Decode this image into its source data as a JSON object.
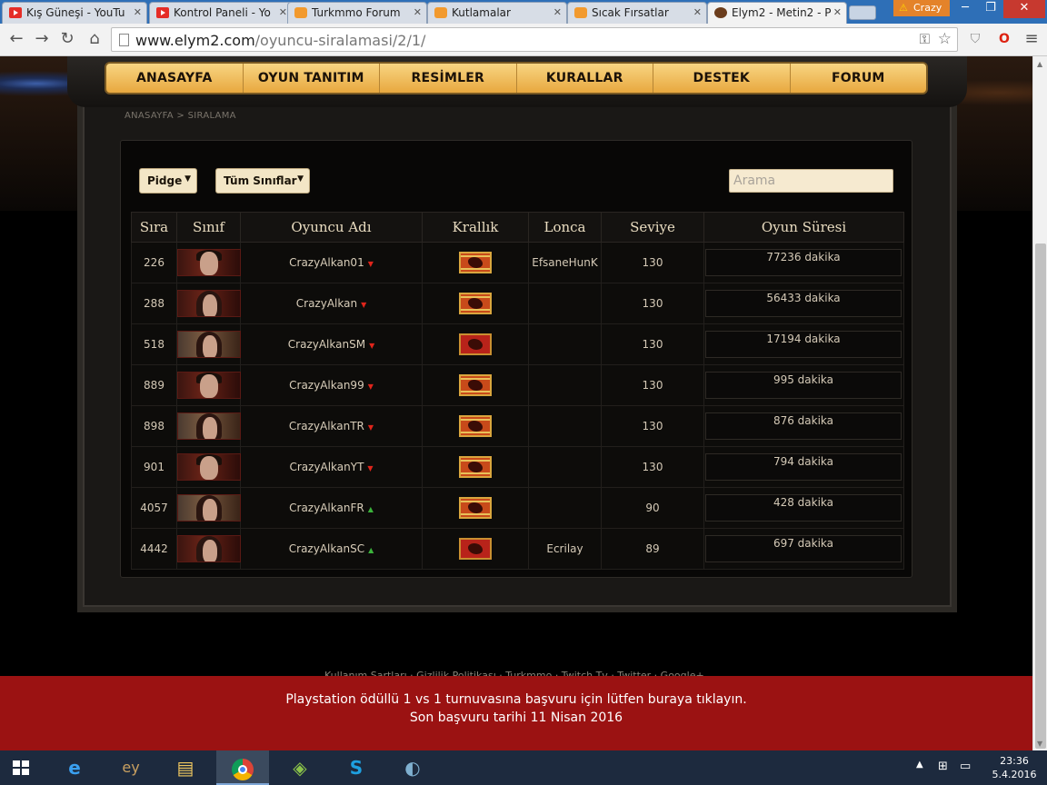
{
  "browser": {
    "tabs": [
      {
        "title": "Kış Güneşi - YouTu",
        "favicon": "youtube-icon"
      },
      {
        "title": "Kontrol Paneli - Yo",
        "favicon": "youtube-icon"
      },
      {
        "title": "Turkmmo Forum",
        "favicon": "turkmmo-icon"
      },
      {
        "title": "Kutlamalar",
        "favicon": "turkmmo-icon"
      },
      {
        "title": "Sıcak Fırsatlar",
        "favicon": "turkmmo-icon"
      },
      {
        "title": "Elym2 - Metin2 - P",
        "favicon": "elym2-icon",
        "active": true
      }
    ],
    "profile_name": "Crazy",
    "url_host": "www.elym2.com",
    "url_path": "/oyuncu-siralamasi/2/1/"
  },
  "nav": {
    "items": [
      "ANASAYFA",
      "OYUN TANITIM",
      "RESİMLER",
      "KURALLAR",
      "DESTEK",
      "FORUM"
    ]
  },
  "breadcrumb": "ANASAYFA > SIRALAMA",
  "filters": {
    "server": "Pidge",
    "class": "Tüm Sınıflar",
    "search_placeholder": "Arama"
  },
  "table": {
    "headers": [
      "Sıra",
      "Sınıf",
      "Oyuncu Adı",
      "Krallık",
      "Lonca",
      "Seviye",
      "Oyun Süresi"
    ],
    "rows": [
      {
        "rank": "226",
        "portrait": "male",
        "name": "CrazyAlkan01",
        "trend": "down",
        "kingdom": "jinno",
        "guild": "EfsaneHunK",
        "level": "130",
        "playtime": "77236 dakika"
      },
      {
        "rank": "288",
        "portrait": "female",
        "name": "CrazyAlkan",
        "trend": "down",
        "kingdom": "jinno",
        "guild": "",
        "level": "130",
        "playtime": "56433 dakika"
      },
      {
        "rank": "518",
        "portrait": "female-sm",
        "name": "CrazyAlkanSM",
        "trend": "down",
        "kingdom": "shinsoo",
        "guild": "",
        "level": "130",
        "playtime": "17194 dakika"
      },
      {
        "rank": "889",
        "portrait": "male",
        "name": "CrazyAlkan99",
        "trend": "down",
        "kingdom": "jinno",
        "guild": "",
        "level": "130",
        "playtime": "995 dakika"
      },
      {
        "rank": "898",
        "portrait": "female-sm",
        "name": "CrazyAlkanTR",
        "trend": "down",
        "kingdom": "jinno",
        "guild": "",
        "level": "130",
        "playtime": "876 dakika"
      },
      {
        "rank": "901",
        "portrait": "male",
        "name": "CrazyAlkanYT",
        "trend": "down",
        "kingdom": "jinno",
        "guild": "",
        "level": "130",
        "playtime": "794 dakika"
      },
      {
        "rank": "4057",
        "portrait": "female-sm",
        "name": "CrazyAlkanFR",
        "trend": "up",
        "kingdom": "jinno",
        "guild": "",
        "level": "90",
        "playtime": "428 dakika"
      },
      {
        "rank": "4442",
        "portrait": "female",
        "name": "CrazyAlkanSC",
        "trend": "up",
        "kingdom": "shinsoo",
        "guild": "Ecrilay",
        "level": "89",
        "playtime": "697 dakika"
      }
    ]
  },
  "footer_links": "Kullanım Şartları · Gizlilik Politikası · Turkmmo · Twitch.Tv · Twitter · Google+",
  "banner": {
    "line1": "Playstation ödüllü 1 vs 1 turnuvasına başvuru için lütfen buraya tıklayın.",
    "line2": "Son başvuru tarihi 11 Nisan 2016"
  },
  "taskbar": {
    "time": "23:36",
    "date": "5.4.2016"
  },
  "colors": {
    "accent_gold": "#e8a83f",
    "banner_red": "#9b1212",
    "trend_down": "#e0251b",
    "trend_up": "#3bb33b"
  }
}
